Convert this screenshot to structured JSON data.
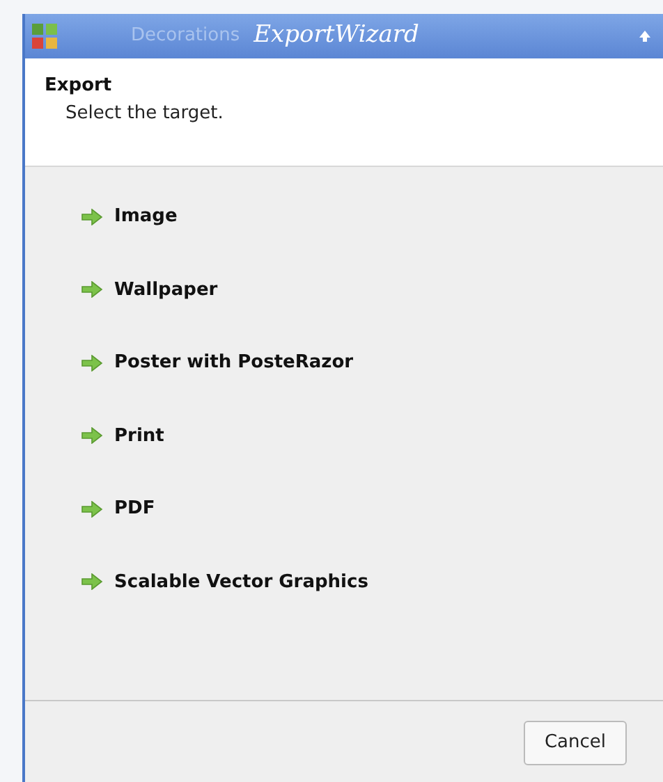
{
  "window": {
    "title": "ExportWizard",
    "background_title": "Decorations"
  },
  "header": {
    "title": "Export",
    "subtitle": "Select the target."
  },
  "options": [
    {
      "label": "Image"
    },
    {
      "label": "Wallpaper"
    },
    {
      "label": "Poster with PosteRazor"
    },
    {
      "label": "Print"
    },
    {
      "label": "PDF"
    },
    {
      "label": "Scalable Vector Graphics"
    }
  ],
  "buttons": [
    "Cancel"
  ]
}
